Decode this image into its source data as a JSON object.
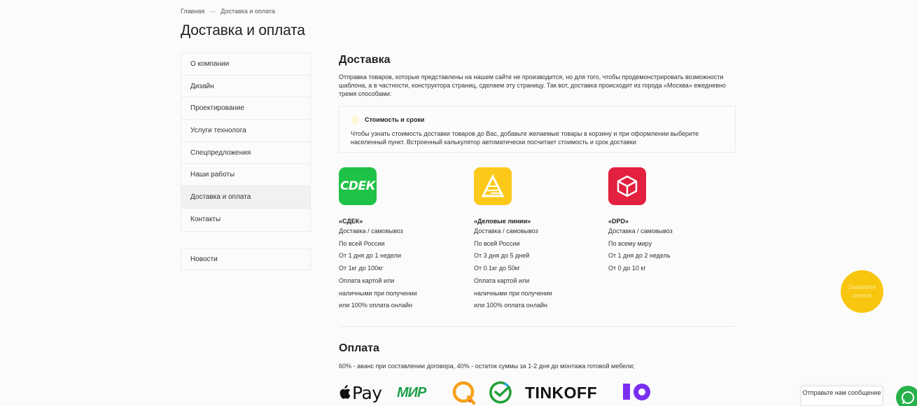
{
  "breadcrumb": {
    "home": "Главная",
    "separator": "—",
    "current": "Доставка и оплата"
  },
  "page_title": "Доставка и оплата",
  "sidebar": {
    "items": [
      {
        "label": "О компании"
      },
      {
        "label": "Дизайн"
      },
      {
        "label": "Проектирование"
      },
      {
        "label": "Услуги технолога"
      },
      {
        "label": "Спецпредложения"
      },
      {
        "label": "Наши работы"
      },
      {
        "label": "Доставка и оплата",
        "active": true
      },
      {
        "label": "Контакты"
      }
    ],
    "news": "Новости"
  },
  "delivery": {
    "title": "Доставка",
    "intro": "Отправка товаров, которые представлены на нашем сайте не производится, но для того, чтобы продемонстрировать возможности шаблона, а в частности, конструктора страниц, сделаем эту страницу. Так вот, доставка происходит из города «Москва» ежедневно тремя способами:",
    "box": {
      "title": "Стоимость и сроки",
      "text": "Чтобы узнать стоимость доставки товаров до Вас, добавьте желаемые товары в корзину и при оформлении выберите населенный пункт. Встроенный калькулятор автоматически посчитает стоимость и срок доставки"
    },
    "carriers": [
      {
        "logo_text": "СDЕК",
        "name": "«СДЕК»",
        "lines": [
          "Доставка / самовывоз",
          "По всей России",
          "От 1 дня до 1 недели",
          "От 1кг до 100кг",
          "Оплата картой или",
          "наличными при получении",
          "или 100% оплата онлайн"
        ],
        "color": "#1ec246"
      },
      {
        "name": "«Деловые линии»",
        "lines": [
          "Доставка / самовывоз",
          "По всей России",
          "От 3 дня до 5 дней",
          "От 0.1кг до 50кг",
          "Оплата картой или",
          "наличными при получении",
          "или 100% оплата онлайн"
        ],
        "color": "#fcc91a"
      },
      {
        "name": "«DPD»",
        "lines": [
          "Доставка / самовывоз",
          "По всему миру",
          "От 1 дня до 2 недель",
          "От 0 до 10 кг"
        ],
        "color": "#e3203e"
      }
    ]
  },
  "payment": {
    "title": "Оплата",
    "text": "60% - аванс при составлении договора, 40% - остаток суммы за 1-2 дня до монтажа готовой мебели;",
    "logos": {
      "applepay": "Pay",
      "mir": "МИР",
      "tinkoff": "TINKOFF"
    }
  },
  "widgets": {
    "callback": "Закажите звонок",
    "chat": "Отправьте нам сообщение"
  },
  "colors": {
    "accent_yellow": "#f8c60f",
    "whatsapp_green": "#27b14a"
  }
}
